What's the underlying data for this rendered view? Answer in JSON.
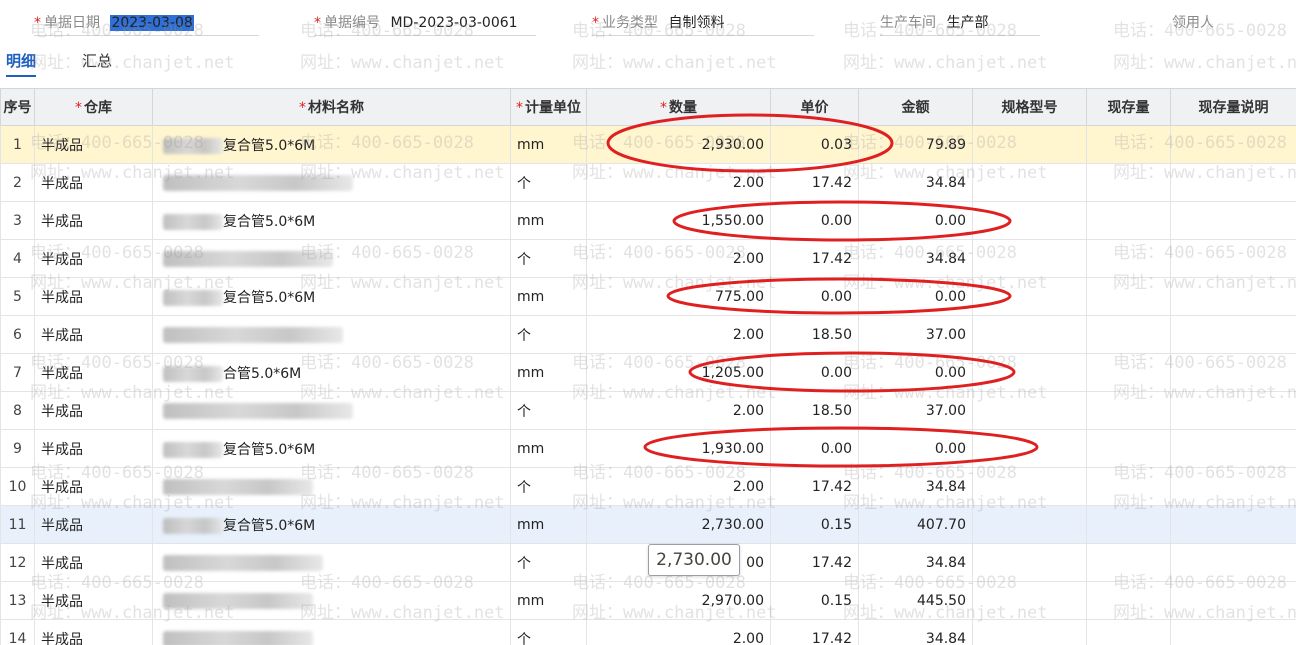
{
  "header": {
    "date_label": "单据日期",
    "date_value": "2023-03-08",
    "docno_label": "单据编号",
    "docno_value": "MD-2023-03-0061",
    "biztype_label": "业务类型",
    "biztype_value": "自制领料",
    "workshop_label": "生产车间",
    "workshop_value": "生产部",
    "receiver_label": "领用人"
  },
  "tabs": {
    "detail": "明细",
    "summary": "汇总"
  },
  "watermark": {
    "phone": "电话：400-665-0028",
    "site": "网址：www.chanjet.net"
  },
  "table": {
    "columns": {
      "no": "序号",
      "warehouse": "仓库",
      "material": "材料名称",
      "unit": "计量单位",
      "qty": "数量",
      "price": "单价",
      "amount": "金额",
      "spec": "规格型号",
      "stock": "现存量",
      "stock_note": "现存量说明"
    },
    "rows": [
      {
        "no": "1",
        "warehouse": "半成品",
        "name": "复合管5.0*6M",
        "unit": "mm",
        "qty": "2,930.00",
        "price": "0.03",
        "amount": "79.89"
      },
      {
        "no": "2",
        "warehouse": "半成品",
        "name": "",
        "unit": "个",
        "qty": "2.00",
        "price": "17.42",
        "amount": "34.84"
      },
      {
        "no": "3",
        "warehouse": "半成品",
        "name": "复合管5.0*6M",
        "unit": "mm",
        "qty": "1,550.00",
        "price": "0.00",
        "amount": "0.00"
      },
      {
        "no": "4",
        "warehouse": "半成品",
        "name": "",
        "unit": "个",
        "qty": "2.00",
        "price": "17.42",
        "amount": "34.84"
      },
      {
        "no": "5",
        "warehouse": "半成品",
        "name": "复合管5.0*6M",
        "unit": "mm",
        "qty": "775.00",
        "price": "0.00",
        "amount": "0.00"
      },
      {
        "no": "6",
        "warehouse": "半成品",
        "name": "",
        "unit": "个",
        "qty": "2.00",
        "price": "18.50",
        "amount": "37.00"
      },
      {
        "no": "7",
        "warehouse": "半成品",
        "name": "合管5.0*6M",
        "unit": "mm",
        "qty": "1,205.00",
        "price": "0.00",
        "amount": "0.00"
      },
      {
        "no": "8",
        "warehouse": "半成品",
        "name": "",
        "unit": "个",
        "qty": "2.00",
        "price": "18.50",
        "amount": "37.00"
      },
      {
        "no": "9",
        "warehouse": "半成品",
        "name": "复合管5.0*6M",
        "unit": "mm",
        "qty": "1,930.00",
        "price": "0.00",
        "amount": "0.00"
      },
      {
        "no": "10",
        "warehouse": "半成品",
        "name": "",
        "unit": "个",
        "qty": "2.00",
        "price": "17.42",
        "amount": "34.84"
      },
      {
        "no": "11",
        "warehouse": "半成品",
        "name": "复合管5.0*6M",
        "unit": "mm",
        "qty": "2,730.00",
        "price": "0.15",
        "amount": "407.70"
      },
      {
        "no": "12",
        "warehouse": "半成品",
        "name": "",
        "unit": "个",
        "qty": "00",
        "price": "17.42",
        "amount": "34.84"
      },
      {
        "no": "13",
        "warehouse": "半成品",
        "name": "",
        "unit": "mm",
        "qty": "2,970.00",
        "price": "0.15",
        "amount": "445.50"
      },
      {
        "no": "14",
        "warehouse": "半成品",
        "name": "",
        "unit": "个",
        "qty": "2.00",
        "price": "17.42",
        "amount": "34.84"
      }
    ]
  },
  "tooltip": {
    "value": "2,730.00"
  },
  "colors": {
    "accent": "#1f5fbf",
    "required": "#e02020",
    "annotation": "#e02020",
    "row_highlight": "#fff6d0",
    "row_selected": "#e8f0fb"
  }
}
